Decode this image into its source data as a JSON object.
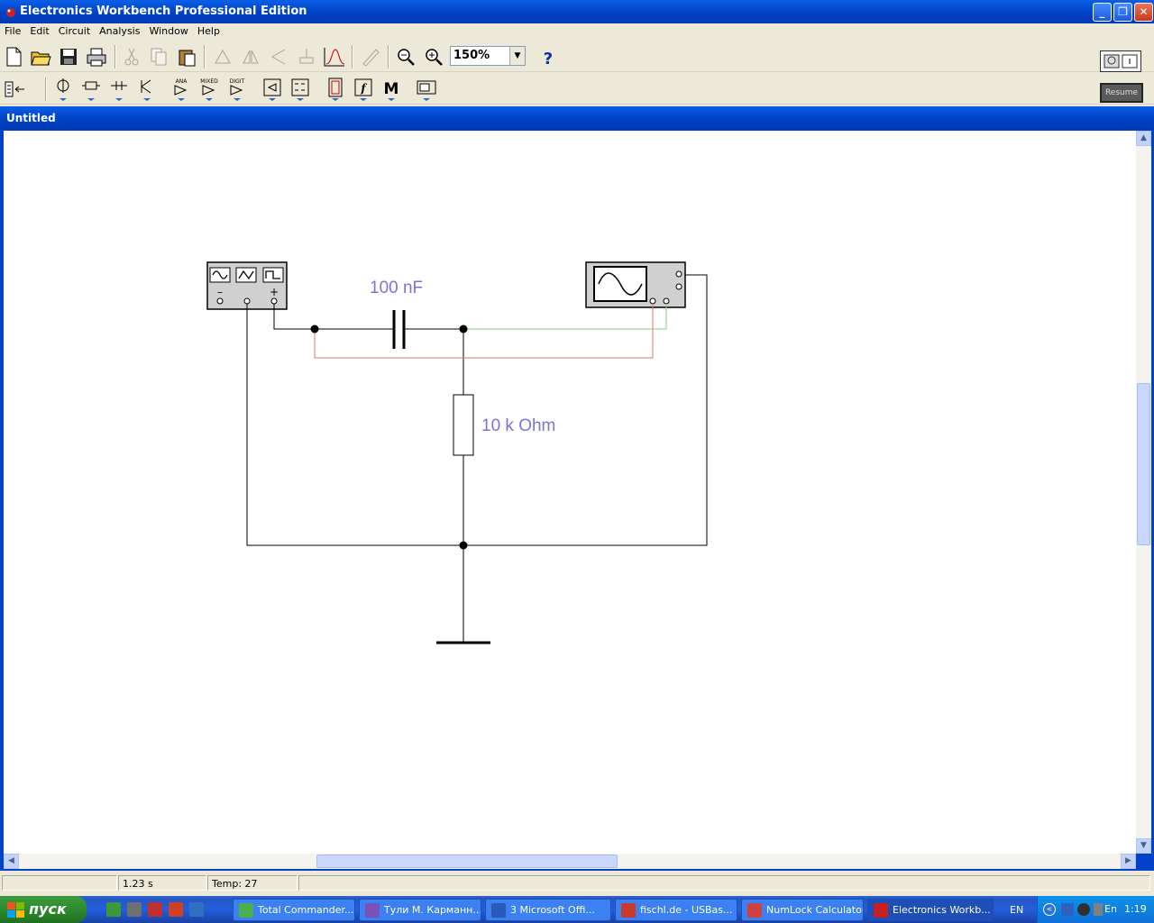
{
  "window": {
    "title": "Electronics Workbench Professional Edition"
  },
  "menu": [
    "File",
    "Edit",
    "Circuit",
    "Analysis",
    "Window",
    "Help"
  ],
  "toolbar": {
    "zoom_value": "150%",
    "help_label": "?",
    "parts_labels": {
      "analog": "ANA",
      "mixed": "MIXED",
      "digital": "DIGIT",
      "misc": "M"
    },
    "resume_label": "Resume"
  },
  "document": {
    "title": "Untitled"
  },
  "circuit": {
    "capacitor_label": "100 nF",
    "resistor_label": "10 k Ohm",
    "wire_colors": {
      "main": "#000000",
      "probe_a": "#e07070",
      "probe_b": "#80d080"
    }
  },
  "status": {
    "time": "1.23 s",
    "temp": "Temp:  27"
  },
  "taskbar": {
    "start_label": "пуск",
    "tasks": [
      {
        "label": "Total Commander...",
        "color": "#4cae4c"
      },
      {
        "label": "Тули М. Карманн...",
        "color": "#7a52b8"
      },
      {
        "label": "3 Microsoft Offi...",
        "color": "#2a5ab8"
      },
      {
        "label": "fischl.de - USBas...",
        "color": "#c83a2a"
      },
      {
        "label": "NumLock Calculator",
        "color": "#d04040"
      },
      {
        "label": "Electronics Workb...",
        "color": "#c82020"
      }
    ],
    "lang": "EN",
    "tray_lang": "En",
    "clock": "1:19"
  }
}
